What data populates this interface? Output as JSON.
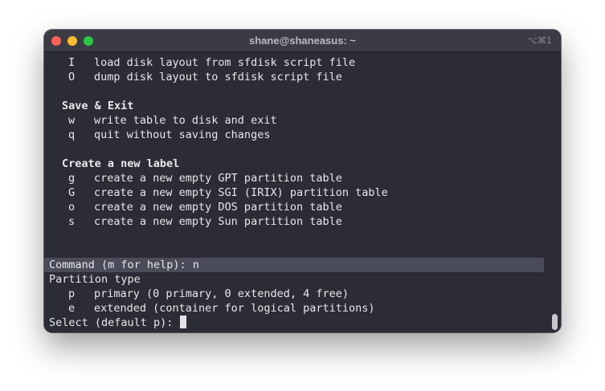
{
  "window": {
    "title": "shane@shaneasus: ~",
    "shortcut": "⌥⌘1"
  },
  "terminal": {
    "script_section": [
      {
        "key": "I",
        "desc": "load disk layout from sfdisk script file"
      },
      {
        "key": "O",
        "desc": "dump disk layout to sfdisk script file"
      }
    ],
    "save_exit": {
      "heading": "Save & Exit",
      "items": [
        {
          "key": "w",
          "desc": "write table to disk and exit"
        },
        {
          "key": "q",
          "desc": "quit without saving changes"
        }
      ]
    },
    "create_label": {
      "heading": "Create a new label",
      "items": [
        {
          "key": "g",
          "desc": "create a new empty GPT partition table"
        },
        {
          "key": "G",
          "desc": "create a new empty SGI (IRIX) partition table"
        },
        {
          "key": "o",
          "desc": "create a new empty DOS partition table"
        },
        {
          "key": "s",
          "desc": "create a new empty Sun partition table"
        }
      ]
    },
    "command_line": "Command (m for help): n",
    "partition_type": {
      "heading": "Partition type",
      "items": [
        {
          "key": "p",
          "desc": "primary (0 primary, 0 extended, 4 free)"
        },
        {
          "key": "e",
          "desc": "extended (container for logical partitions)"
        }
      ]
    },
    "prompt": "Select (default p): "
  },
  "colors": {
    "background": "#2b2c35",
    "titlebar": "#3a3b45",
    "text": "#e8e8ea",
    "highlight": "#4b4c5a"
  }
}
